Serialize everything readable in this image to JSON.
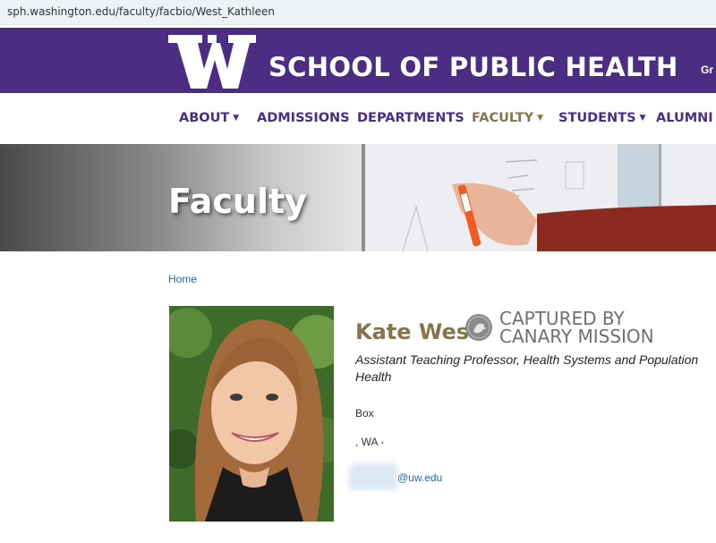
{
  "browser": {
    "url": "sph.washington.edu/faculty/facbio/West_Kathleen"
  },
  "header": {
    "title": "SCHOOL OF PUBLIC HEALTH",
    "right_text": "Gr",
    "logo_letter": "W"
  },
  "nav": [
    {
      "label": "ABOUT",
      "has_dropdown": true
    },
    {
      "label": "ADMISSIONS",
      "has_dropdown": false
    },
    {
      "label": "DEPARTMENTS",
      "has_dropdown": false
    },
    {
      "label": "FACULTY",
      "has_dropdown": true,
      "active": true
    },
    {
      "label": "STUDENTS",
      "has_dropdown": true
    },
    {
      "label": "ALUMNI",
      "has_dropdown": true
    }
  ],
  "hero": {
    "title": "Faculty"
  },
  "breadcrumb": {
    "home": "Home"
  },
  "profile": {
    "name": "Kate West",
    "title": "Assistant Teaching Professor, Health Systems and Population Health",
    "address_line1": "Box",
    "address_line2": ", WA -",
    "email_domain": "@uw.edu"
  },
  "watermark": {
    "line1": "CAPTURED BY",
    "line2": "CANARY MISSION"
  },
  "colors": {
    "uw_purple": "#4b2e83",
    "uw_gold": "#85754d",
    "link_blue": "#1d6fa5"
  }
}
